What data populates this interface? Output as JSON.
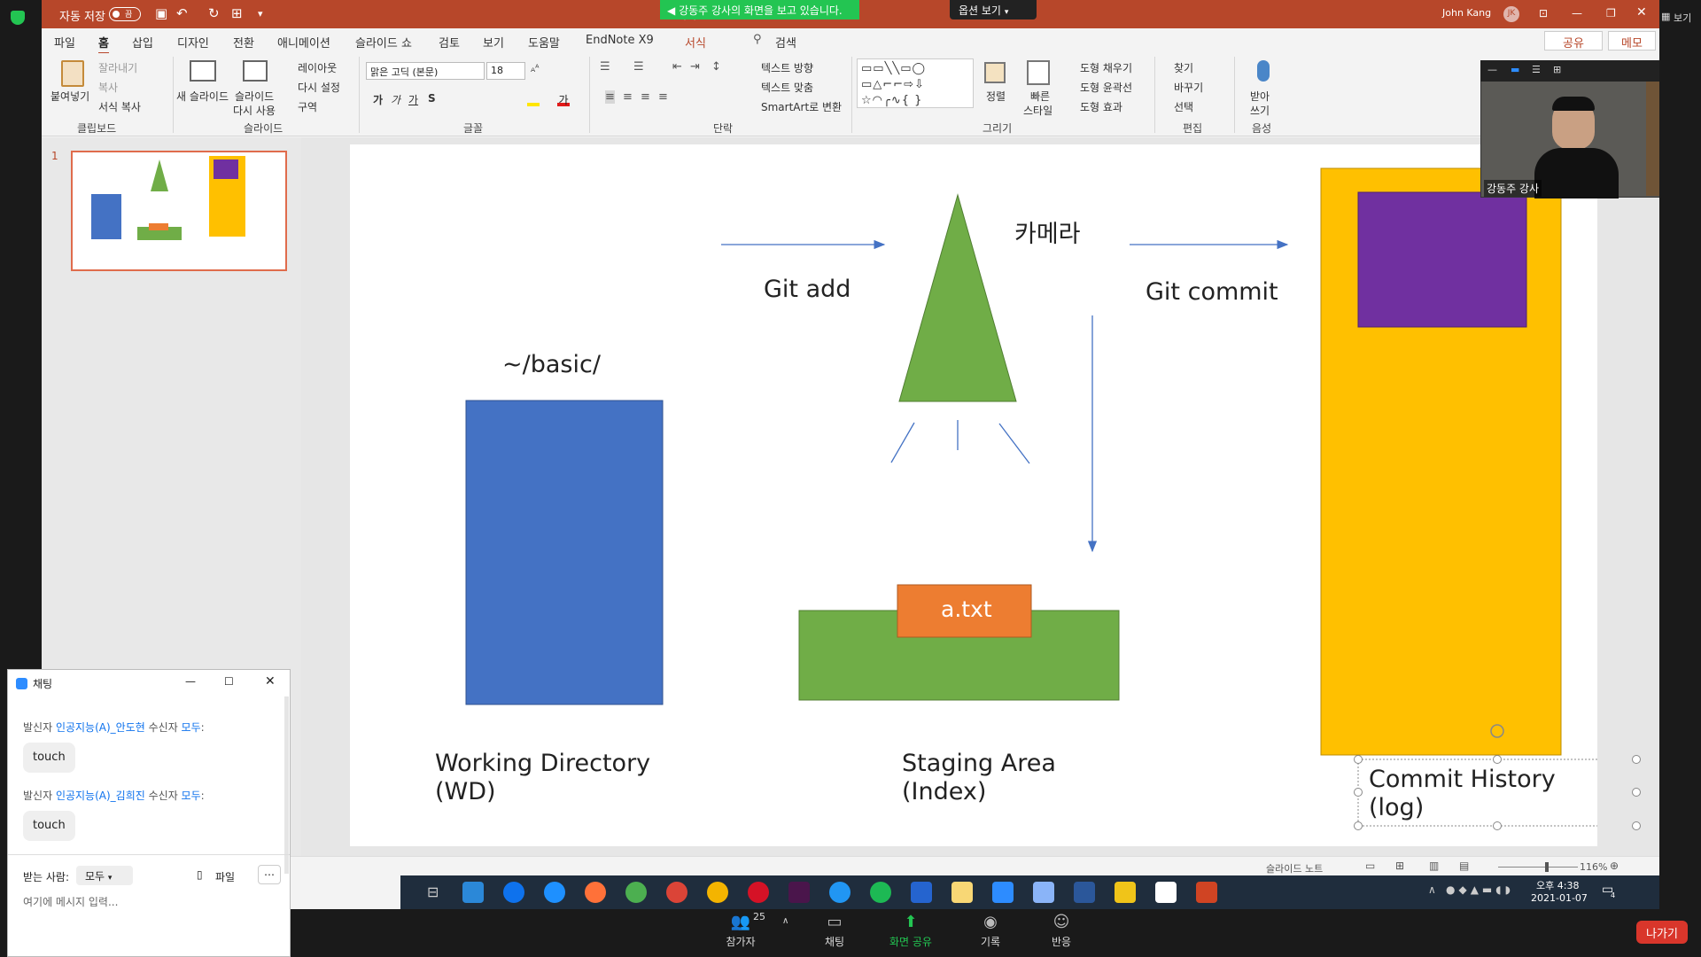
{
  "ppt": {
    "autosave_label": "자동 저장",
    "autosave_state": "끔",
    "doc_title": "그리기",
    "user_name": "John Kang",
    "user_initials": "JK",
    "view_label": "보기",
    "tabs": [
      "파일",
      "홈",
      "삽입",
      "디자인",
      "전환",
      "애니메이션",
      "슬라이드 쇼",
      "검토",
      "보기",
      "도움말",
      "EndNote X9",
      "서식"
    ],
    "search_label": "검색",
    "share_label": "공유",
    "memo_label": "메모"
  },
  "zoom": {
    "share_banner": "강동주 강사의 화면을 보고 있습니다.",
    "view_options": "옵션 보기",
    "bottom": {
      "participants_count": "25",
      "participants_label": "참가자",
      "chat_label": "채팅",
      "share_label": "화면 공유",
      "record_label": "기록",
      "reactions_label": "반응",
      "leave_label": "나가기"
    },
    "cam_name": "강동주 강사"
  },
  "ribbon": {
    "clipboard": {
      "paste": "붙여넣기",
      "cut": "잘라내기",
      "copy": "복사",
      "format_painter": "서식 복사",
      "group": "클립보드"
    },
    "slides": {
      "new_slide": "새 슬라이드",
      "reuse_line1": "슬라이드",
      "reuse_line2": "다시 사용",
      "layout": "레이아웃",
      "reset": "다시 설정",
      "section": "구역",
      "group": "슬라이드"
    },
    "font": {
      "font_name": "맑은 고딕 (본문)",
      "font_size": "18",
      "group": "글꼴"
    },
    "paragraph": {
      "text_direction": "텍스트 방향",
      "align_text": "텍스트 맞춤",
      "smartart": "SmartArt로 변환",
      "group": "단락"
    },
    "drawing": {
      "arrange": "정렬",
      "quick_styles_line1": "빠른",
      "quick_styles_line2": "스타일",
      "fill": "도형 채우기",
      "outline": "도형 윤곽선",
      "effects": "도형 효과",
      "group": "그리기"
    },
    "editing": {
      "find": "찾기",
      "replace": "바꾸기",
      "select": "선택",
      "group": "편집"
    },
    "voice": {
      "dictate_line1": "받아",
      "dictate_line2": "쓰기",
      "group": "음성"
    }
  },
  "slide_pane": {
    "slide_number": "1"
  },
  "slide": {
    "path_label": "~/basic/",
    "git_add": "Git add",
    "camera": "카메라",
    "git_commit": "Git commit",
    "file_label": "a.txt",
    "wd_line1": "Working Directory",
    "wd_line2": "(WD)",
    "staging_line1": "Staging Area",
    "staging_line2": "(Index)",
    "commit_line1": "Commit History",
    "commit_line2": "(log)",
    "colors": {
      "blue": "#4472c4",
      "green": "#70ad47",
      "orange": "#ed7d31",
      "yellow": "#ffc000",
      "purple": "#7030a0",
      "arrow": "#4472c4"
    }
  },
  "statusbar": {
    "notes": "슬라이드 노트",
    "zoom": "116%"
  },
  "taskbar": {
    "time": "오후 4:38",
    "date": "2021-01-07",
    "notif_count": "4"
  },
  "chat": {
    "title": "채팅",
    "messages": [
      {
        "prefix": "발신자 ",
        "from": "인공지능(A)_안도현",
        "mid": " 수신자 ",
        "to": "모두",
        "suffix": ":",
        "text": "touch"
      },
      {
        "prefix": "발신자 ",
        "from": "인공지능(A)_김희진",
        "mid": " 수신자 ",
        "to": "모두",
        "suffix": ":",
        "text": "touch"
      }
    ],
    "to_label": "받는 사람:",
    "to_value": "모두",
    "file_label": "파일",
    "placeholder": "여기에 메시지 입력..."
  }
}
